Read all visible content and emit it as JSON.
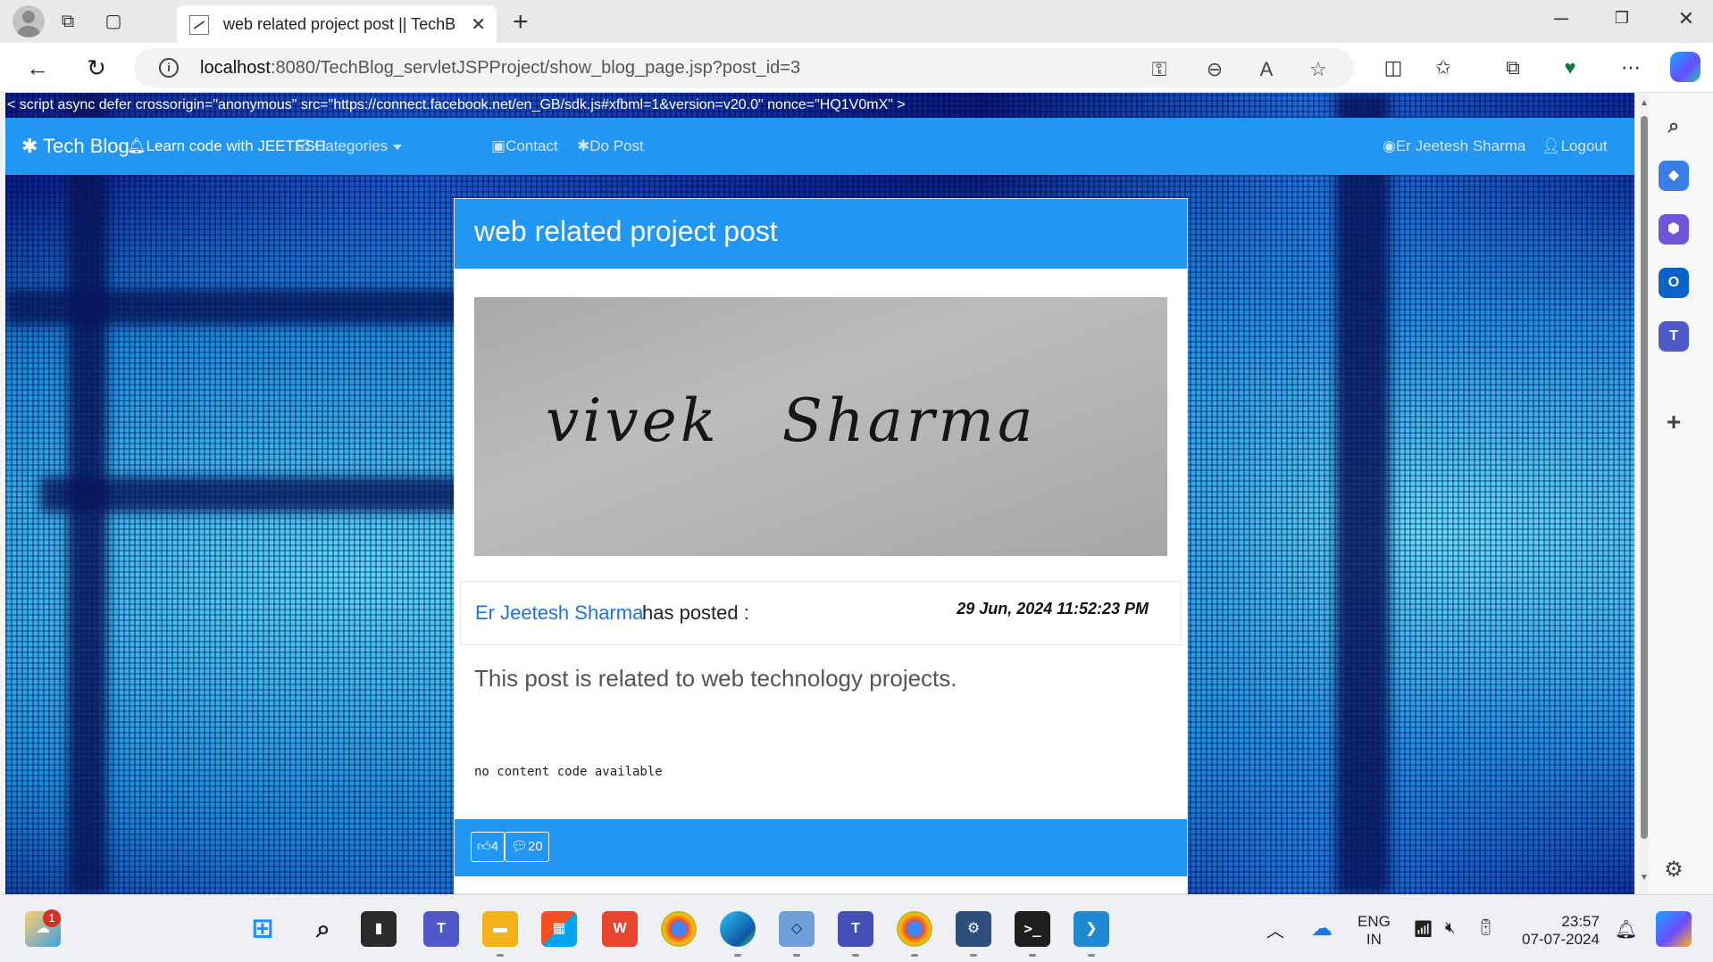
{
  "browser": {
    "tab_title": "web related project post || TechB",
    "url_host": "localhost",
    "url_rest": ":8080/TechBlog_servletJSPProject/show_blog_page.jsp?post_id=3"
  },
  "page": {
    "script_text": "< script async defer crossorigin=\"anonymous\" src=\"https://connect.facebook.net/en_GB/sdk.js#xfbml=1&version=v20.0\" nonce=\"HQ1V0mX\" >",
    "navbar": {
      "brand": "✱ Tech Blog",
      "learn": "Learn code with JEETESH",
      "categories": "Categories",
      "contact": "Contact",
      "do_post": "Do Post",
      "user": "Er Jeetesh Sharma",
      "logout": "Logout"
    },
    "post": {
      "title": "web related project post",
      "image_text_1": "vivek",
      "image_text_2": "Sharma",
      "author": "Er Jeetesh Sharma",
      "posted_label": "has posted :",
      "date": "29 Jun, 2024 11:52:23 PM",
      "content": "This post is related to web technology projects.",
      "code": "no content code available",
      "likes": "4",
      "comments": "20"
    }
  },
  "taskbar": {
    "notification_count": "1",
    "lang_1": "ENG",
    "lang_2": "IN",
    "time": "23:57",
    "date": "07-07-2024"
  }
}
